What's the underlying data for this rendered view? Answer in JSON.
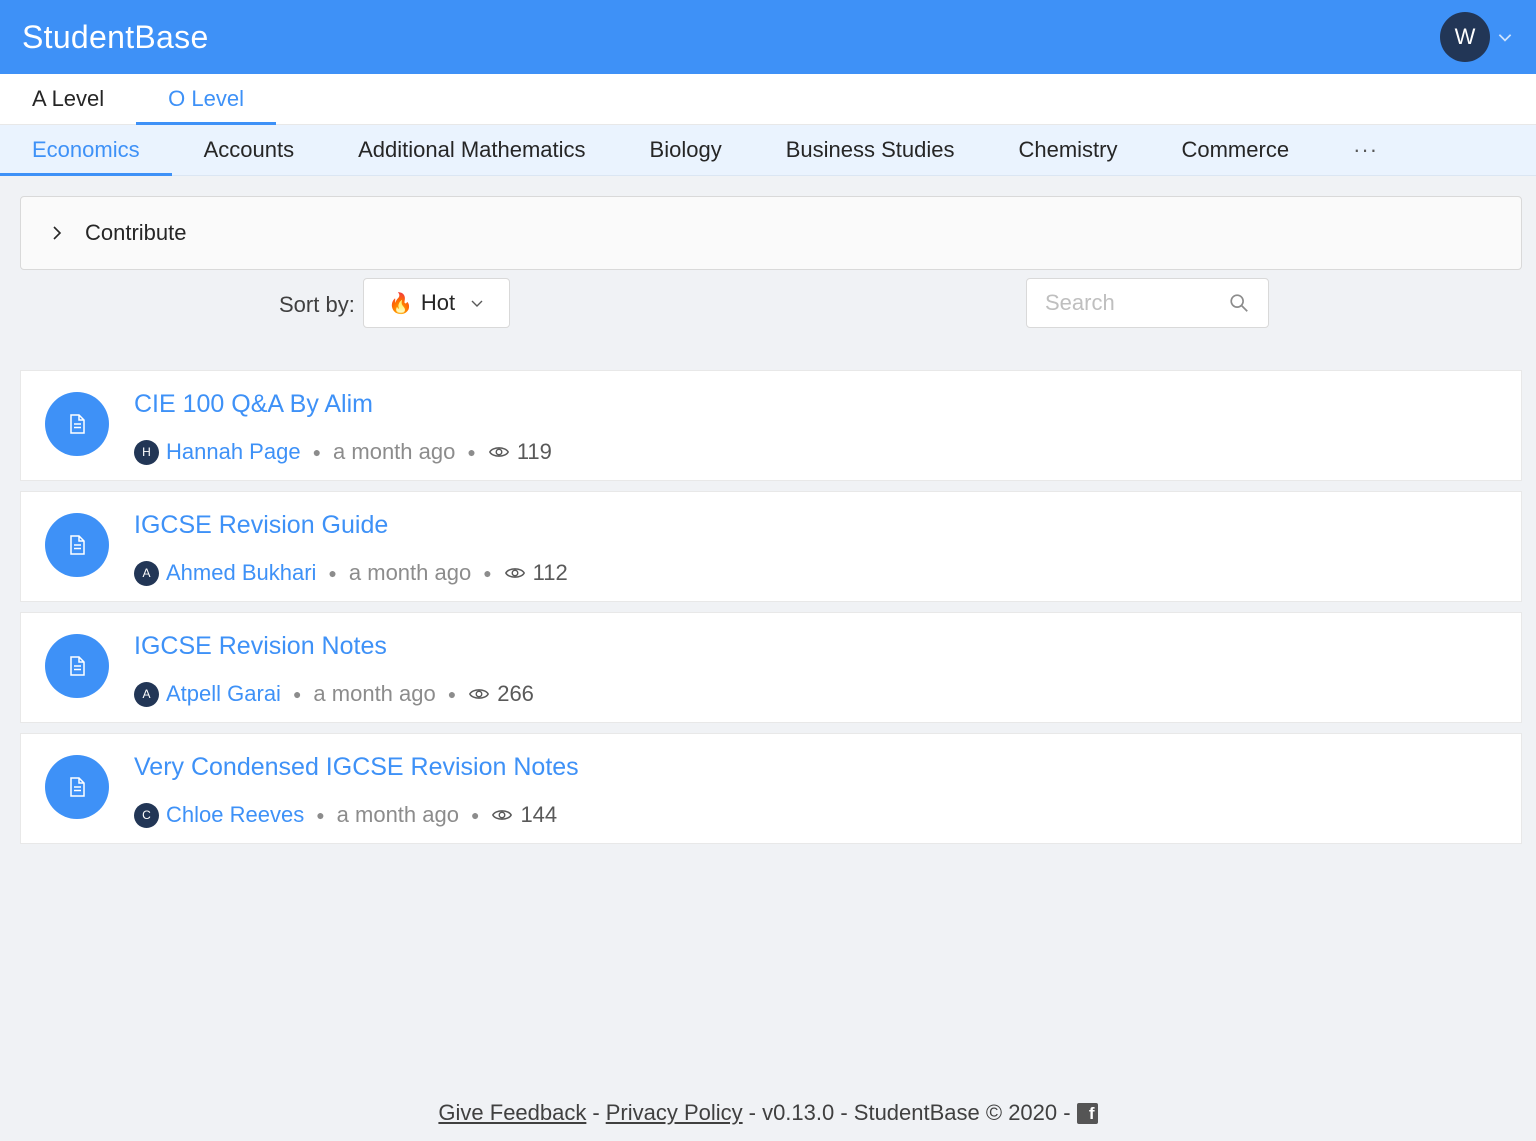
{
  "header": {
    "brand": "StudentBase",
    "user_initial": "W"
  },
  "level_tabs": [
    {
      "label": "A Level",
      "active": false
    },
    {
      "label": "O Level",
      "active": true
    }
  ],
  "subject_tabs": [
    {
      "label": "Economics",
      "active": true
    },
    {
      "label": "Accounts",
      "active": false
    },
    {
      "label": "Additional Mathematics",
      "active": false
    },
    {
      "label": "Biology",
      "active": false
    },
    {
      "label": "Business Studies",
      "active": false
    },
    {
      "label": "Chemistry",
      "active": false
    },
    {
      "label": "Commerce",
      "active": false
    }
  ],
  "more_tabs": "···",
  "contribute": {
    "label": "Contribute"
  },
  "toolbar": {
    "sort_label": "Sort by:",
    "sort_value": "Hot",
    "sort_icon": "🔥",
    "search_placeholder": "Search"
  },
  "posts": [
    {
      "title": "CIE 100 Q&A By Alim",
      "author_initial": "H",
      "author": "Hannah Page",
      "time": "a month ago",
      "views": "119"
    },
    {
      "title": "IGCSE Revision Guide",
      "author_initial": "A",
      "author": "Ahmed Bukhari",
      "time": "a month ago",
      "views": "112"
    },
    {
      "title": "IGCSE Revision Notes",
      "author_initial": "A",
      "author": "Atpell Garai",
      "time": "a month ago",
      "views": "266"
    },
    {
      "title": "Very Condensed IGCSE Revision Notes",
      "author_initial": "C",
      "author": "Chloe Reeves",
      "time": "a month ago",
      "views": "144"
    }
  ],
  "footer": {
    "feedback": "Give Feedback",
    "sep1": "-",
    "privacy": "Privacy Policy",
    "version_text": "- v0.13.0 - StudentBase © 2020 -",
    "fb_glyph": "f"
  },
  "colors": {
    "primary": "#3e91f7",
    "avatar_dark": "#223656",
    "background": "#f0f2f5"
  }
}
